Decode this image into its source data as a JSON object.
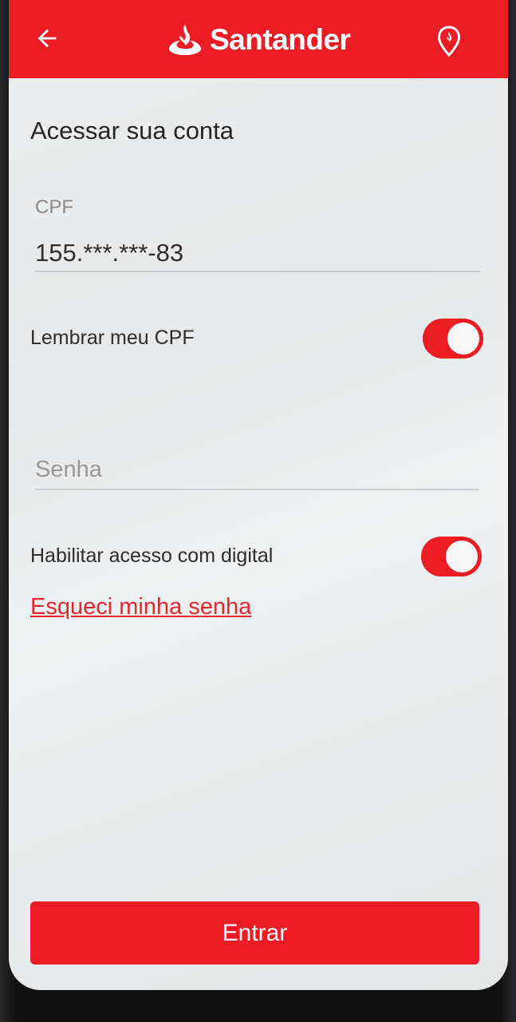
{
  "colors": {
    "brand_red": "#ec1c24",
    "link_red": "#e8262e",
    "screen_bg": "#eceeef"
  },
  "header": {
    "brand_name": "Santander",
    "back_icon": "arrow-left-icon",
    "location_icon": "location-pin-icon",
    "logo_icon": "santander-flame-icon"
  },
  "page": {
    "title": "Acessar sua conta"
  },
  "cpf": {
    "label": "CPF",
    "value": "155.***.***-83"
  },
  "remember_cpf": {
    "label": "Lembrar meu CPF",
    "checked": true
  },
  "password": {
    "placeholder": "Senha",
    "value": ""
  },
  "fingerprint": {
    "label": "Habilitar acesso com digital",
    "checked": true
  },
  "forgot_password": {
    "label": "Esqueci minha senha"
  },
  "submit": {
    "label": "Entrar"
  }
}
